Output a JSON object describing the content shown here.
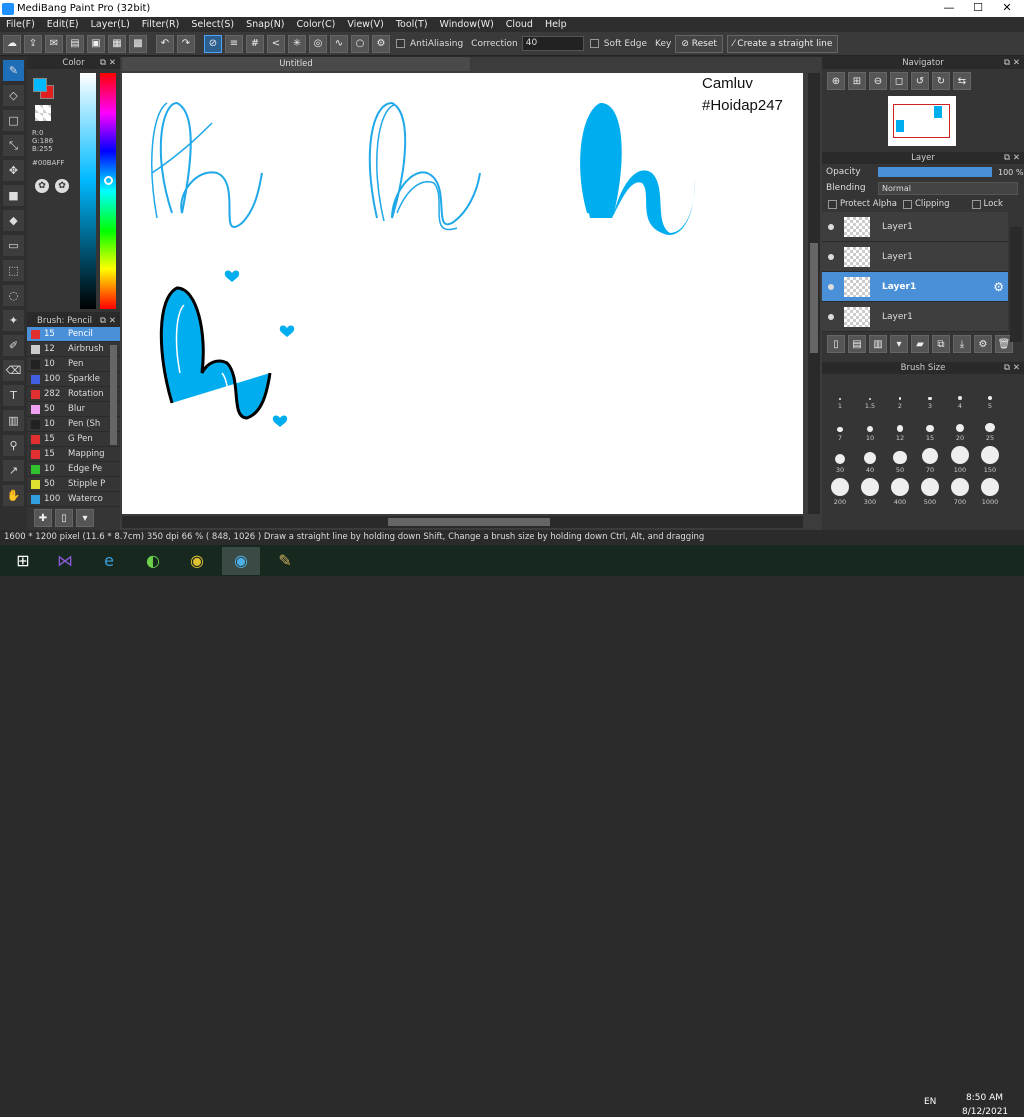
{
  "window": {
    "title": "MediBang Paint Pro (32bit)",
    "minimize": "—",
    "maximize": "☐",
    "close": "✕"
  },
  "menu": [
    "File(F)",
    "Edit(E)",
    "Layer(L)",
    "Filter(R)",
    "Select(S)",
    "Snap(N)",
    "Color(C)",
    "View(V)",
    "Tool(T)",
    "Window(W)",
    "Cloud",
    "Help"
  ],
  "toolbar": {
    "antialiasing_label": "AntiAliasing",
    "correction_label": "Correction",
    "correction_value": "40",
    "soft_edge_label": "Soft Edge",
    "key_label": "Key",
    "reset_label": "Reset",
    "straight_line_label": "Create a straight line"
  },
  "color_panel": {
    "title": "Color",
    "rgb": "R:0\nG:186\nB:255",
    "hex": "#00BAFF",
    "primary_color": "#00baff",
    "secondary_color": "#e02020"
  },
  "brush_panel": {
    "title": "Brush: Pencil",
    "items": [
      {
        "size": "15",
        "name": "Pencil",
        "color": "#e03030",
        "selected": true
      },
      {
        "size": "12",
        "name": "Airbrush",
        "color": "#cccccc"
      },
      {
        "size": "10",
        "name": "Pen",
        "color": "#222222"
      },
      {
        "size": "100",
        "name": "Sparkle",
        "color": "#3f5fe0"
      },
      {
        "size": "282",
        "name": "Rotation",
        "color": "#e03030"
      },
      {
        "size": "50",
        "name": "Blur",
        "color": "#f0a0f0"
      },
      {
        "size": "10",
        "name": "Pen (Sh",
        "color": "#222222"
      },
      {
        "size": "15",
        "name": "G Pen",
        "color": "#e03030"
      },
      {
        "size": "15",
        "name": "Mapping",
        "color": "#e03030"
      },
      {
        "size": "10",
        "name": "Edge Pe",
        "color": "#30c030"
      },
      {
        "size": "50",
        "name": "Stipple P",
        "color": "#e0e030"
      },
      {
        "size": "100",
        "name": "Waterco",
        "color": "#30a0e0"
      }
    ]
  },
  "canvas": {
    "tab_title": "Untitled",
    "watermark_line1": "Camluv",
    "watermark_line2": "#Hoidap247"
  },
  "navigator": {
    "title": "Navigator"
  },
  "layer_panel": {
    "title": "Layer",
    "opacity_label": "Opacity",
    "opacity_value": "100 %",
    "opacity_fraction": 1.0,
    "blending_label": "Blending",
    "blending_value": "Normal",
    "protect_alpha": "Protect Alpha",
    "clipping": "Clipping",
    "lock": "Lock",
    "layers": [
      {
        "name": "Layer1",
        "selected": false
      },
      {
        "name": "Layer1",
        "selected": false
      },
      {
        "name": "Layer1",
        "selected": true
      },
      {
        "name": "Layer1",
        "selected": false
      }
    ]
  },
  "brush_size": {
    "title": "Brush Size",
    "sizes": [
      "1",
      "1.5",
      "2",
      "3",
      "4",
      "5",
      "7",
      "10",
      "12",
      "15",
      "20",
      "25",
      "30",
      "40",
      "50",
      "70",
      "100",
      "150",
      "200",
      "300",
      "400",
      "500",
      "700",
      "1000"
    ]
  },
  "status_bar": "1600 * 1200 pixel   (11.6 * 8.7cm)   350 dpi   66 %   ( 848, 1026 )   Draw a straight line by holding down Shift, Change a brush size by holding down Ctrl, Alt, and dragging",
  "taskbar": {
    "lang": "EN",
    "time": "8:50 AM",
    "date": "8/12/2021"
  }
}
